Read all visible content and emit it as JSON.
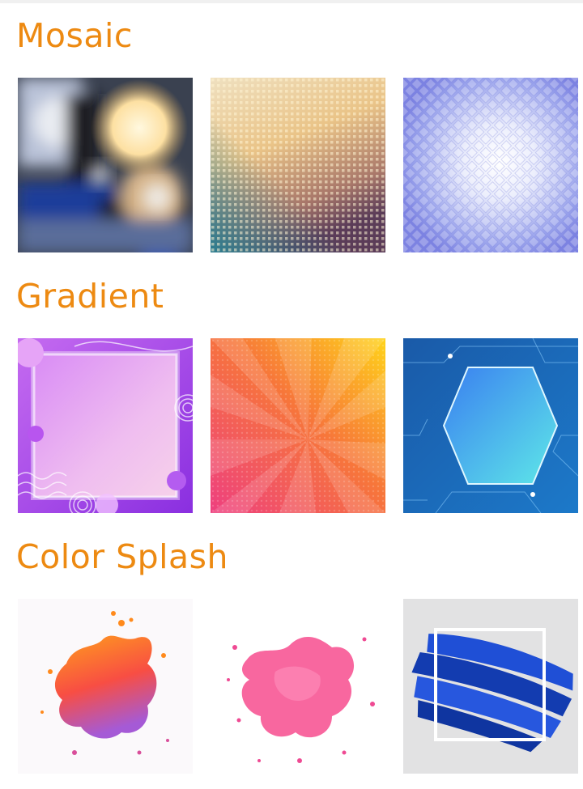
{
  "sections": [
    {
      "title": "Mosaic",
      "tiles": [
        {
          "name": "mosaic-bokeh",
          "colors": [
            "#1d3a8f",
            "#fde6a8",
            "#2b2b2b"
          ]
        },
        {
          "name": "mosaic-golden-dots",
          "colors": [
            "#f3d6a0",
            "#2a6f8c",
            "#e9c77d"
          ]
        },
        {
          "name": "mosaic-blue-glow",
          "colors": [
            "#7f86e6",
            "#ffffff",
            "#a9b4f3"
          ]
        }
      ]
    },
    {
      "title": "Gradient",
      "tiles": [
        {
          "name": "gradient-purple-frame",
          "colors": [
            "#a24ee8",
            "#f0c6f2",
            "#ffffff"
          ]
        },
        {
          "name": "gradient-sunburst",
          "colors": [
            "#ffd21a",
            "#f55a3c",
            "#ef4a86"
          ]
        },
        {
          "name": "gradient-blue-hexagon",
          "colors": [
            "#1767b8",
            "#4ab6f0",
            "#5ae4ea"
          ]
        }
      ]
    },
    {
      "title": "Color Splash",
      "tiles": [
        {
          "name": "splash-orange",
          "colors": [
            "#ff8a1c",
            "#f23a64",
            "#9b59d6"
          ]
        },
        {
          "name": "splash-pink",
          "colors": [
            "#ff6aa6",
            "#f1479a",
            "#ffffff"
          ]
        },
        {
          "name": "splash-blue-brush",
          "colors": [
            "#123fb8",
            "#1e5ae0",
            "#e0e0e0"
          ]
        }
      ]
    }
  ]
}
